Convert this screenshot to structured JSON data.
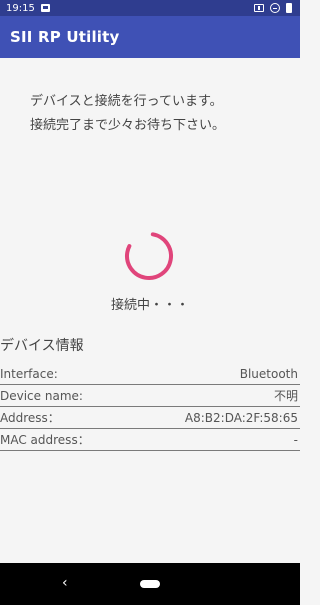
{
  "status_bar": {
    "time": "19:15",
    "icons": [
      "image-icon",
      "vibrate-icon",
      "do-not-disturb-icon",
      "battery-icon"
    ]
  },
  "app_bar": {
    "title": "SII RP Utility",
    "color": "#3f51b5"
  },
  "main": {
    "message": "デバイスと接続を行っています。\n接続完了まで少々お待ち下さい。",
    "connecting_label": "接続中・・・",
    "spinner_color": "#e0457b",
    "section_title": "デバイス情報",
    "info_rows": [
      {
        "label": "Interface:",
        "value": "Bluetooth"
      },
      {
        "label": "Device name:",
        "value": "不明"
      },
      {
        "label": "Address：",
        "value": "A8:B2:DA:2F:58:65"
      },
      {
        "label": "MAC address：",
        "value": "-"
      }
    ]
  },
  "nav_bar": {
    "back_icon": "chevron-left-icon",
    "home_icon": "home-pill-icon"
  }
}
